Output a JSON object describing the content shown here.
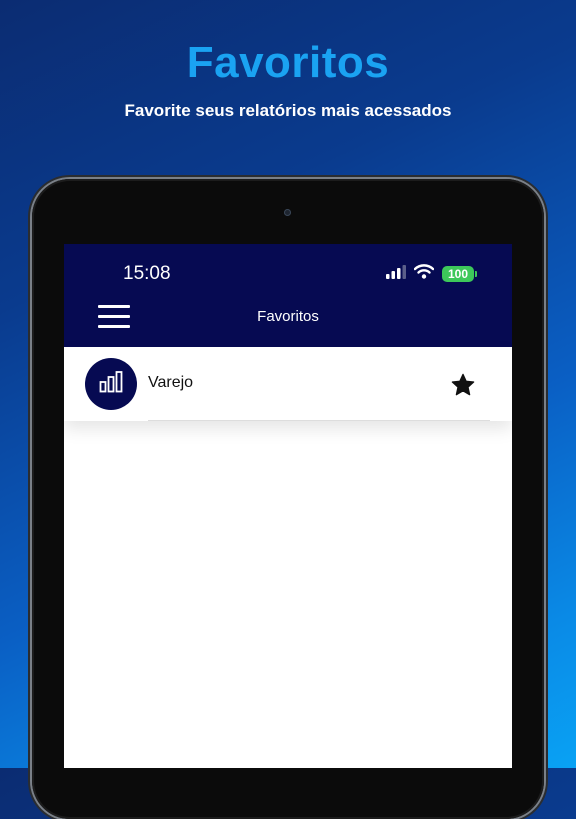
{
  "promo": {
    "title": "Favoritos",
    "subtitle": "Favorite seus relatórios mais acessados"
  },
  "status_bar": {
    "time": "15:08",
    "battery": "100",
    "icons": [
      "signal-icon",
      "wifi-icon",
      "battery-icon"
    ]
  },
  "header": {
    "title": "Favoritos",
    "menu_icon": "hamburger-menu-icon"
  },
  "favorites": [
    {
      "label": "Varejo",
      "icon": "bar-chart-icon",
      "favorited": true
    }
  ],
  "colors": {
    "primary": "#060a52",
    "promo_title": "#1aa3f2",
    "battery": "#3dc85a"
  }
}
